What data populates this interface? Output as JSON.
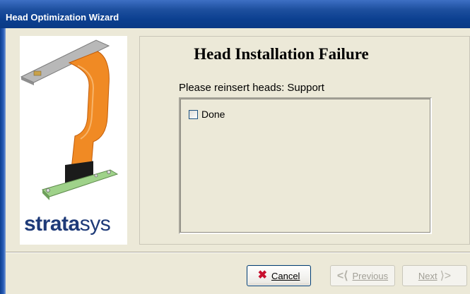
{
  "window": {
    "title": "Head Optimization Wizard"
  },
  "branding": {
    "logo_bold": "strata",
    "logo_thin": "sys"
  },
  "content": {
    "heading": "Head Installation Failure",
    "instruction": "Please reinsert heads: Support",
    "checkbox": {
      "label": "Done",
      "checked": false
    }
  },
  "buttons": {
    "cancel": "Cancel",
    "previous": "Previous",
    "next": "Next"
  },
  "icons": {
    "cancel": "red-x-icon",
    "previous": "left-arrow-icon",
    "next": "right-arrow-icon"
  },
  "colors": {
    "titlebar": "#0b3f8f",
    "cancel_icon": "#c8102e",
    "brand": "#1e3a78"
  }
}
